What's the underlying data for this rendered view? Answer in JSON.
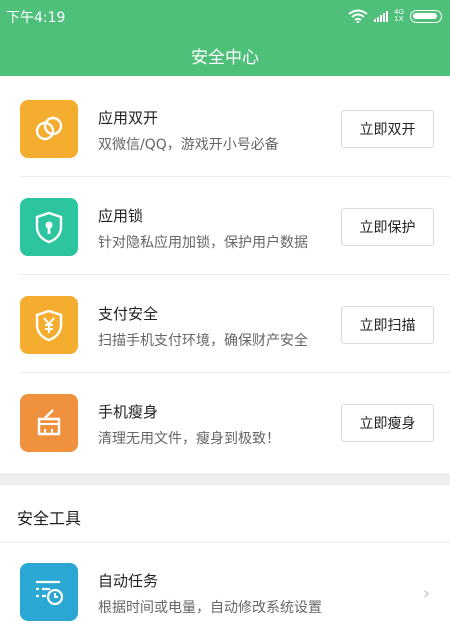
{
  "status": {
    "time": "下午4:19",
    "net_top": "4G",
    "net_bottom": "1X"
  },
  "header": {
    "title": "安全中心"
  },
  "features": [
    {
      "name": "应用双开",
      "desc": "双微信/QQ，游戏开小号必备",
      "button": "立即双开",
      "icon": "dual-circles-icon",
      "color": "#f4ad2e"
    },
    {
      "name": "应用锁",
      "desc": "针对隐私应用加锁，保护用户数据",
      "button": "立即保护",
      "icon": "shield-lock-icon",
      "color": "#2cc5a0"
    },
    {
      "name": "支付安全",
      "desc": "扫描手机支付环境，确保财产安全",
      "button": "立即扫描",
      "icon": "yuan-shield-icon",
      "color": "#f4ad2e"
    },
    {
      "name": "手机瘦身",
      "desc": "清理无用文件，瘦身到极致！",
      "button": "立即瘦身",
      "icon": "broom-icon",
      "color": "#f0913e"
    }
  ],
  "tools": {
    "section_title": "安全工具",
    "items": [
      {
        "name": "自动任务",
        "desc": "根据时间或电量，自动修改系统设置",
        "icon": "task-clock-icon",
        "color": "#2aa8d3"
      }
    ]
  }
}
